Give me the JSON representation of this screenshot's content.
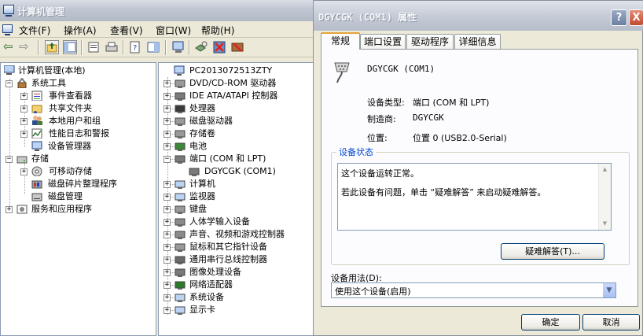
{
  "mmc": {
    "title": "计算机管理",
    "menu": [
      "文件(F)",
      "操作(A)",
      "查看(V)",
      "窗口(W)",
      "帮助(H)"
    ],
    "tree": {
      "root": "计算机管理(本地)",
      "system_tools": "系统工具",
      "event_viewer": "事件查看器",
      "shared_folders": "共享文件夹",
      "local_users": "本地用户和组",
      "perf_logs": "性能日志和警报",
      "device_manager": "设备管理器",
      "storage": "存储",
      "removable_storage": "可移动存储",
      "disk_defrag": "磁盘碎片整理程序",
      "disk_management": "磁盘管理",
      "services_apps": "服务和应用程序"
    },
    "devices": {
      "computer_name": "PC2013072513ZTY",
      "items": [
        "DVD/CD-ROM 驱动器",
        "IDE ATA/ATAPI 控制器",
        "处理器",
        "磁盘驱动器",
        "存储卷",
        "电池",
        "端口 (COM 和 LPT)",
        "DGYCGK (COM1)",
        "计算机",
        "监视器",
        "键盘",
        "人体学输入设备",
        "声音、视频和游戏控制器",
        "鼠标和其它指针设备",
        "通用串行总线控制器",
        "图像处理设备",
        "网络适配器",
        "系统设备",
        "显示卡"
      ]
    }
  },
  "dialog": {
    "title": "DGYCGK (COM1) 属性",
    "help_button": "?",
    "close_button": "X",
    "tabs": [
      "常规",
      "端口设置",
      "驱动程序",
      "详细信息"
    ],
    "device_name": "DGYCGK (COM1)",
    "device_type_label": "设备类型:",
    "device_type_value": "端口 (COM 和 LPT)",
    "manufacturer_label": "制造商:",
    "manufacturer_value": "DGYCGK",
    "location_label": "位置:",
    "location_value": "位置 0 (USB2.0-Serial)",
    "status_group_label": "设备状态",
    "status_line1": "这个设备运转正常。",
    "status_line2": "若此设备有问题，单击 “疑难解答” 来启动疑难解答。",
    "troubleshoot_button": "疑难解答(T)...",
    "usage_label": "设备用法(D):",
    "usage_value": "使用这个设备(启用)",
    "ok_button": "确定",
    "cancel_button": "取消"
  }
}
